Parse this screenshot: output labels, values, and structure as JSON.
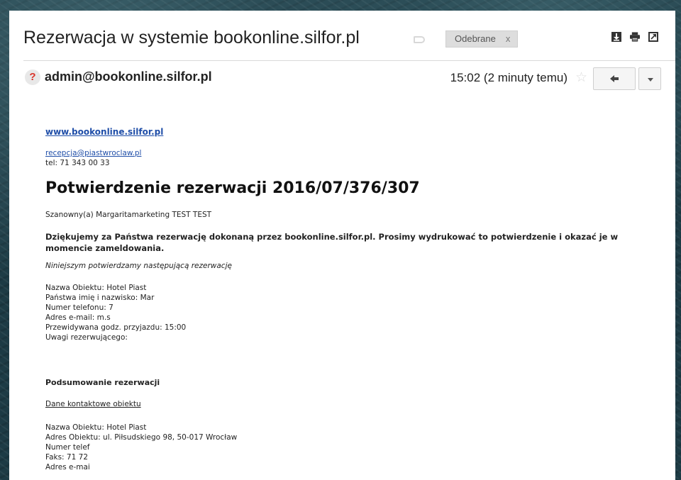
{
  "email": {
    "subject": "Rezerwacja w systemie bookonline.silfor.pl",
    "label": "Odebrane",
    "label_remove": "x",
    "sender": "admin@bookonline.silfor.pl",
    "time": "15:02 (2 minuty temu)",
    "avatar_glyph": "?",
    "star_glyph": "☆",
    "icons": [
      "download-icon",
      "print-icon",
      "open-in-new-window-icon",
      "reply-icon",
      "more-options-icon",
      "star-icon",
      "importance-icon"
    ]
  },
  "message": {
    "website": "www.bookonline.silfor.pl",
    "reception_email": "recepcja@piastwroclaw.pl",
    "phone": "tel: 71 343 00 33",
    "heading": "Potwierdzenie rezerwacji 2016/07/376/307",
    "greeting": "Szanowny(a) Margaritamarketing TEST TEST",
    "thanks": "Dziękujemy za Państwa rezerwację dokonaną przez bookonline.silfor.pl. Prosimy wydrukować to potwierdzenie i okazać je w momencie zameldowania.",
    "confirm_intro": "Niniejszym potwierdzamy następującą rezerwację",
    "details": [
      "Nazwa Obiektu: Hotel Piast",
      "Państwa imię i nazwisko: Mar",
      "Numer telefonu: 7",
      "Adres e-mail: m.s",
      "Przewidywana godz. przyjazdu: 15:00",
      "Uwagi rezerwującego:"
    ],
    "summary_title": "Podsumowanie rezerwacji",
    "contact_title": "Dane kontaktowe obiektu",
    "contact_lines": [
      "Nazwa Obiektu: Hotel Piast",
      "Adres Obiektu: ul. Piłsudskiego 98, 50-017 Wrocław",
      "Numer telef",
      "Faks: 71 72",
      "Adres e-mai"
    ]
  },
  "colors": {
    "link": "#1f4ea8",
    "background": "#1d3b45",
    "unknown_sender": "#d9352b"
  }
}
